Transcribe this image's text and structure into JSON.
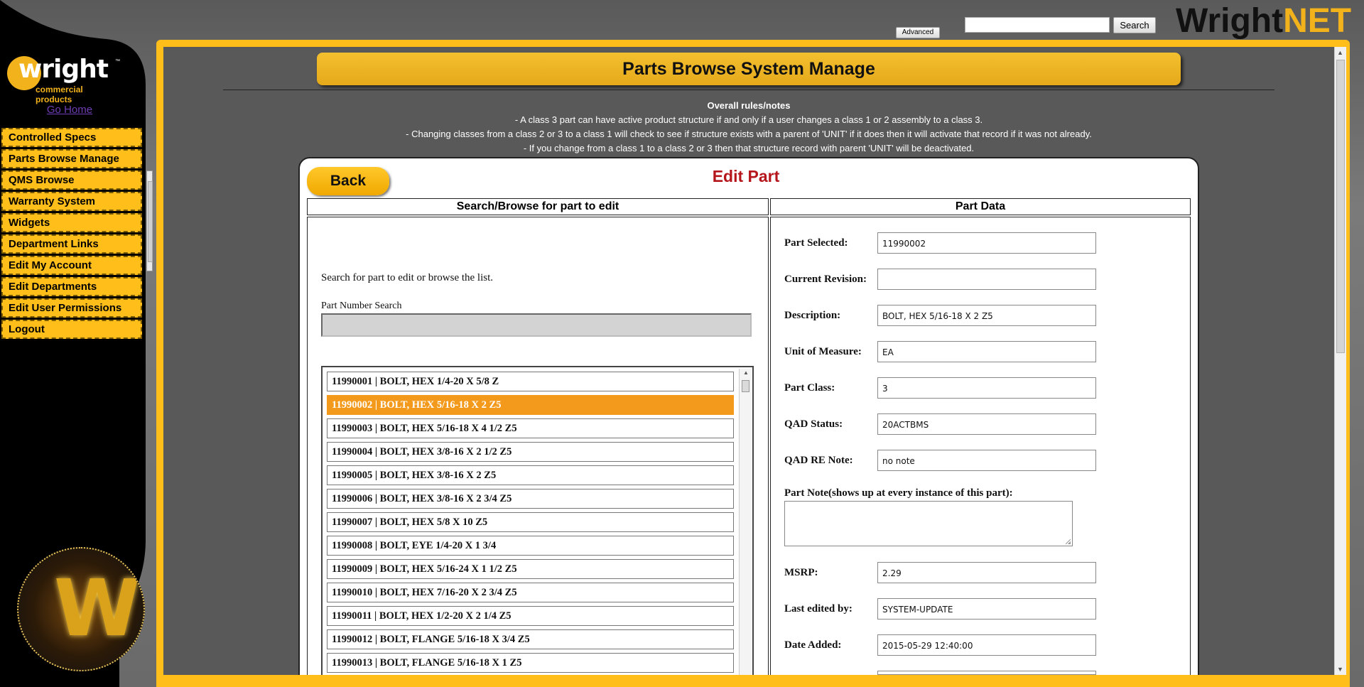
{
  "header": {
    "search_placeholder": "",
    "search_button": "Search",
    "advanced_button": "Advanced",
    "brand_part1": "Wright",
    "brand_part2": "NET"
  },
  "sidebar": {
    "logo_word": "wright",
    "logo_sub": "commercial products",
    "go_home": "Go Home",
    "items": [
      {
        "label": "Controlled Specs"
      },
      {
        "label": "Parts Browse Manage"
      },
      {
        "label": "QMS Browse"
      },
      {
        "label": "Warranty System"
      },
      {
        "label": "Widgets"
      },
      {
        "label": "Department Links"
      },
      {
        "label": "Edit My Account"
      },
      {
        "label": "Edit Departments"
      },
      {
        "label": "Edit User Permissions"
      },
      {
        "label": "Logout"
      }
    ],
    "badge_letter": "W"
  },
  "main": {
    "banner": "Parts Browse System Manage",
    "rules_title": "Overall rules/notes",
    "rules": [
      "- A class 3 part can have active product structure if and only if a user changes a class 1 or 2 assembly to a class 3.",
      "- Changing classes from a class 2 or 3 to a class 1 will check to see if structure exists with a parent of 'UNIT' if it does then it will activate that record if it was not already.",
      "- If you change from a class 1 to a class 2 or 3 then that structure record with parent 'UNIT' will be deactivated."
    ],
    "back_button": "Back",
    "edit_title": "Edit Part",
    "left_header": "Search/Browse for part to edit",
    "right_header": "Part Data",
    "search_hint": "Search for part to edit or browse the list.",
    "pn_label": "Part Number Search",
    "pn_value": "",
    "parts": [
      "11990001 | BOLT, HEX 1/4-20 X 5/8 Z",
      "11990002 | BOLT, HEX 5/16-18 X 2 Z5",
      "11990003 | BOLT, HEX 5/16-18 X 4 1/2 Z5",
      "11990004 | BOLT, HEX 3/8-16 X 2 1/2 Z5",
      "11990005 | BOLT, HEX 3/8-16 X 2 Z5",
      "11990006 | BOLT, HEX 3/8-16 X 2 3/4 Z5",
      "11990007 | BOLT, HEX 5/8 X 10 Z5",
      "11990008 | BOLT, EYE 1/4-20 X 1 3/4",
      "11990009 | BOLT, HEX 5/16-24 X 1 1/2 Z5",
      "11990010 | BOLT, HEX 7/16-20 X 2 3/4 Z5",
      "11990011 | BOLT, HEX 1/2-20 X 2 1/4 Z5",
      "11990012 | BOLT, FLANGE 5/16-18 X 3/4 Z5",
      "11990013 | BOLT, FLANGE 5/16-18 X 1 Z5"
    ],
    "selected_index": 1,
    "fields": {
      "part_selected_label": "Part Selected:",
      "part_selected": "11990002",
      "current_revision_label": "Current Revision:",
      "current_revision": "",
      "description_label": "Description:",
      "description": "BOLT, HEX 5/16-18 X 2 Z5",
      "uom_label": "Unit of Measure:",
      "uom": "EA",
      "part_class_label": "Part Class:",
      "part_class": "3",
      "qad_status_label": "QAD Status:",
      "qad_status": "20ACTBMS",
      "qad_re_note_label": "QAD RE Note:",
      "qad_re_note": "no note",
      "part_note_label": "Part Note(shows up at every instance of this part):",
      "part_note": "",
      "msrp_label": "MSRP:",
      "msrp": "2.29",
      "last_edited_label": "Last edited by:",
      "last_edited": "SYSTEM-UPDATE",
      "date_added_label": "Date Added:",
      "date_added": "2015-05-29 12:40:00"
    }
  }
}
